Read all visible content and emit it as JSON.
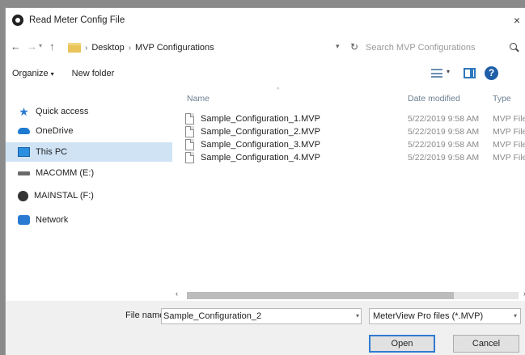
{
  "window": {
    "title": "Read Meter Config File",
    "close_glyph": "×"
  },
  "nav": {
    "back_glyph": "←",
    "forward_glyph": "→",
    "up_glyph": "↑"
  },
  "address": {
    "crumbs": [
      "Desktop",
      "MVP Configurations"
    ],
    "separator": "›",
    "refresh_glyph": "↻"
  },
  "search": {
    "placeholder": "Search MVP Configurations"
  },
  "toolbar": {
    "organize_label": "Organize",
    "new_folder_label": "New folder",
    "help_glyph": "?"
  },
  "sidebar": {
    "items": [
      {
        "label": "Quick access",
        "icon": "star-icon"
      },
      {
        "label": "OneDrive",
        "icon": "cloud-icon"
      },
      {
        "label": "This PC",
        "icon": "computer-icon",
        "selected": true
      },
      {
        "label": "MACOMM (E:)",
        "icon": "drive-icon"
      },
      {
        "label": "MAINSTAL (F:)",
        "icon": "disc-icon"
      },
      {
        "label": "Network",
        "icon": "network-icon"
      }
    ]
  },
  "filelist": {
    "columns": {
      "name": "Name",
      "date": "Date modified",
      "type": "Type"
    },
    "files": [
      {
        "name": "Sample_Configuration_1.MVP",
        "date": "5/22/2019 9:58 AM",
        "type": "MVP File"
      },
      {
        "name": "Sample_Configuration_2.MVP",
        "date": "5/22/2019 9:58 AM",
        "type": "MVP File"
      },
      {
        "name": "Sample_Configuration_3.MVP",
        "date": "5/22/2019 9:58 AM",
        "type": "MVP File"
      },
      {
        "name": "Sample_Configuration_4.MVP",
        "date": "5/22/2019 9:58 AM",
        "type": "MVP File"
      }
    ]
  },
  "footer": {
    "file_name_label": "File name:",
    "file_name_value": "Sample_Configuration_2",
    "file_type_value": "MeterView Pro files (*.MVP)",
    "open_label": "Open",
    "cancel_label": "Cancel"
  }
}
